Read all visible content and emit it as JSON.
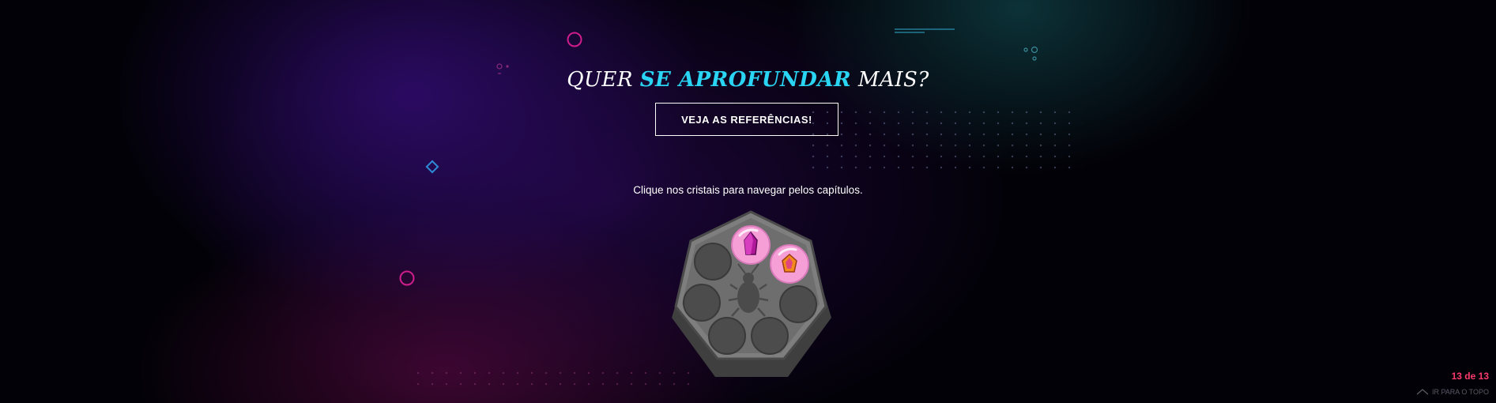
{
  "headline": {
    "part1": "QUER ",
    "highlight": "SE APROFUNDAR",
    "part2": " MAIS?"
  },
  "references_button": {
    "label": "VEJA AS REFERÊNCIAS!"
  },
  "hint": "Clique nos cristais para navegar pelos capítulos.",
  "chapter_wheel": {
    "slots": [
      {
        "chapter": 1,
        "state": "unlocked",
        "icon": "magenta-crystal-icon"
      },
      {
        "chapter": 2,
        "state": "unlocked",
        "icon": "orange-crystal-icon"
      },
      {
        "chapter": 3,
        "state": "locked"
      },
      {
        "chapter": 4,
        "state": "locked"
      },
      {
        "chapter": 5,
        "state": "locked"
      },
      {
        "chapter": 6,
        "state": "locked"
      },
      {
        "chapter": 7,
        "state": "locked"
      }
    ],
    "center_icon": "cockroach-icon"
  },
  "pagination": {
    "counter": "13 de 13"
  },
  "back_to_top": {
    "label": "IR PARA O TOPO",
    "icon": "chevron-up-icon"
  },
  "colors": {
    "accent_cyan": "#2ad4f3",
    "accent_pink": "#ff3b6e",
    "crystal_bubble": "#f59fd6"
  }
}
